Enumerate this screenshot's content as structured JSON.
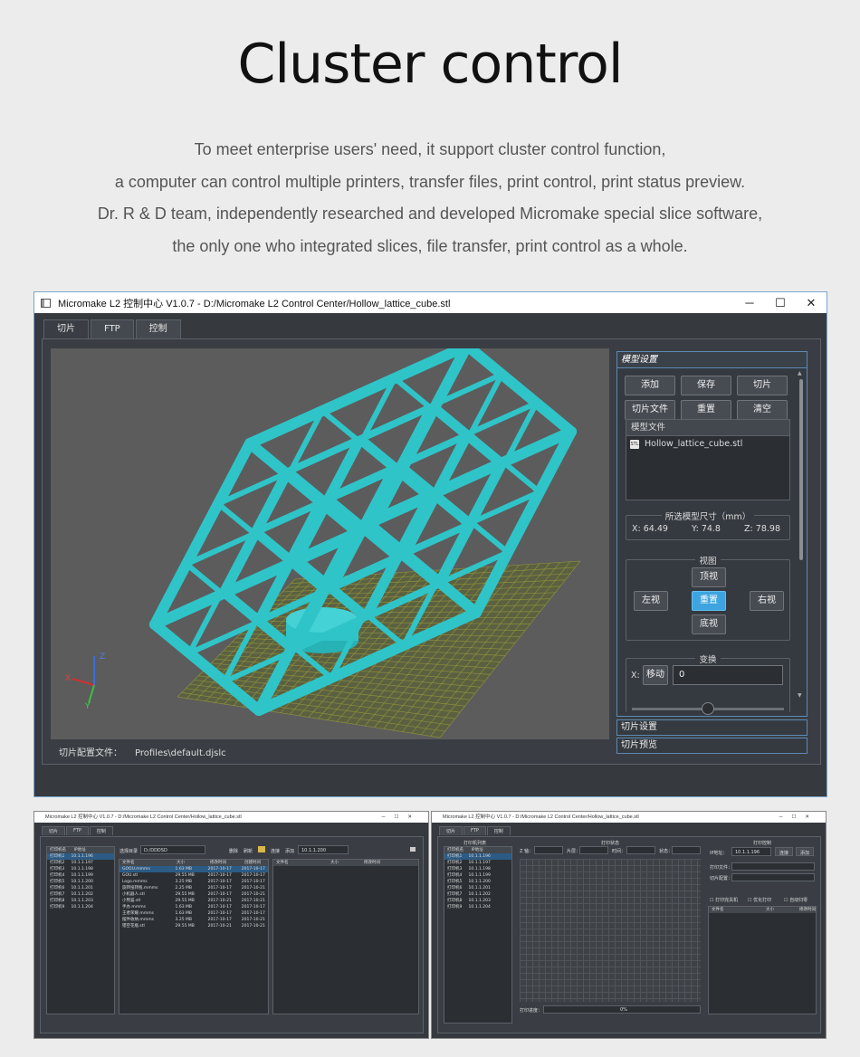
{
  "heading": "Cluster control",
  "intro": [
    "To meet enterprise users' need, it support cluster control function,",
    "a computer can control multiple printers, transfer files, print control, print status preview.",
    "Dr. R & D team, independently researched and developed Micromake special slice software,",
    "the only one who integrated slices, file transfer, print control as a whole."
  ],
  "window": {
    "title": "Micromake L2 控制中心 V1.0.7 - D:/Micromake L2 Control Center/Hollow_lattice_cube.stl",
    "controls": {
      "minimize": "─",
      "maximize": "☐",
      "close": "✕"
    },
    "tabs": [
      "切片",
      "FTP",
      "控制"
    ],
    "profile_label": "切片配置文件：",
    "profile_value": "Profiles\\default.djslc",
    "panel": {
      "title": "模型设置",
      "buttons": [
        "添加",
        "保存",
        "切片",
        "切片文件",
        "重置",
        "清空"
      ],
      "file_header": "模型文件",
      "file_name": "Hollow_lattice_cube.stl",
      "file_icon_text": "STL",
      "dims_label": "所选模型尺寸（mm）",
      "dims": {
        "x_label": "X:",
        "x": "64.49",
        "y_label": "Y:",
        "y": "74.8",
        "z_label": "Z:",
        "z": "78.98"
      },
      "view_label": "视图",
      "view_buttons": {
        "top": "顶视",
        "left": "左视",
        "reset": "重置",
        "right": "右视",
        "bottom": "底视"
      },
      "transform_label": "变换",
      "axis_x": "X:",
      "move": "移动",
      "move_value": "0",
      "slider_fraction": 0.5
    },
    "sections": [
      "切片设置",
      "切片预览"
    ],
    "axis_letters": {
      "x": "X",
      "y": "Y",
      "z": "Z"
    },
    "colors": {
      "model": "#2fc4c8",
      "grid": "#9c9c3c",
      "accent": "#3da4e0"
    }
  },
  "mini_left": {
    "title": "Micromake L2 控制中心 V1.0.7 - D:/Micromake L2 Control Center/Hollow_lattice_cube.stl",
    "tabs": [
      "切片",
      "FTP",
      "控制"
    ],
    "printer_headers": [
      "打印机名",
      "IP地址"
    ],
    "printers": [
      [
        "打印机1",
        "10.1.1.196"
      ],
      [
        "打印机2",
        "10.1.1.197"
      ],
      [
        "打印机3",
        "10.1.1.198"
      ],
      [
        "打印机4",
        "10.1.1.199"
      ],
      [
        "打印机5",
        "10.1.1.200"
      ],
      [
        "打印机6",
        "10.1.1.201"
      ],
      [
        "打印机7",
        "10.1.1.202"
      ],
      [
        "打印机8",
        "10.1.1.203"
      ],
      [
        "打印机9",
        "10.1.1.204"
      ]
    ],
    "dir_label": "选择目录",
    "dir_value": "D:/DDDSD",
    "actions": [
      "删除",
      "刷新",
      "连接",
      "添加"
    ],
    "ip_value": "10.1.1.200",
    "file_headers": [
      "文件名",
      "大小",
      "修改时间",
      "创建时间"
    ],
    "files": [
      [
        "GOOU.mmms",
        "1.63 MB",
        "2017-10-17",
        "2017-10-17"
      ],
      [
        "GOU.stl",
        "29.55 MB",
        "2017-10-17",
        "2017-10-17"
      ],
      [
        "Logo.mmms",
        "3.25 MB",
        "2017-10-17",
        "2017-10-17"
      ],
      [
        "旋转扭转瓶.mmms",
        "2.25 MB",
        "2017-10-17",
        "2017-10-21"
      ],
      [
        "小机器人.stl",
        "29.55 MB",
        "2017-10-17",
        "2017-10-21"
      ],
      [
        "小熊猫.stl",
        "29.55 MB",
        "2017-10-21",
        "2017-10-21"
      ],
      [
        "手办.mmms",
        "1.63 MB",
        "2017-10-17",
        "2017-10-17"
      ],
      [
        "王者荣耀.mmms",
        "1.63 MB",
        "2017-10-17",
        "2017-10-17"
      ],
      [
        "摆件收纳.mmms",
        "3.25 MB",
        "2017-10-17",
        "2017-10-21"
      ],
      [
        "镂空花瓶.stl",
        "29.55 MB",
        "2017-10-21",
        "2017-10-21"
      ]
    ],
    "remote_headers": [
      "文件名",
      "大小",
      "修改时间"
    ]
  },
  "mini_right": {
    "title": "Micromake L2 控制中心 V1.0.7 - D:/Micromake L2 Control Center/Hollow_lattice_cube.stl",
    "tabs": [
      "切片",
      "FTP",
      "控制"
    ],
    "list_title": "打印机列表",
    "status_title": "打印状态",
    "control_title": "打印控制",
    "status_fields": [
      "Z 轴：",
      "片层：",
      "时间：",
      "状态："
    ],
    "progress_label": "打印进度：",
    "progress_value": "0%",
    "ip_label": "IP地址：",
    "ip_value": "10.1.1.196",
    "buttons": [
      "连接",
      "添加"
    ],
    "print_file_label": "打印文件：",
    "slice_cfg_label": "切片配置：",
    "checks": [
      "打印完关机",
      "优化打印",
      "自动归零"
    ],
    "file_headers": [
      "文件名",
      "大小",
      "修改时间"
    ]
  }
}
